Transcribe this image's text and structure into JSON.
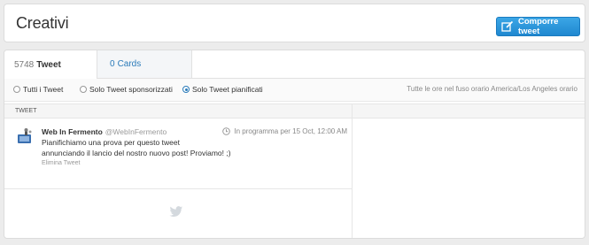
{
  "header": {
    "title": "Creativi",
    "compose_button_label": "Comporre tweet",
    "compose_icon": "compose-icon"
  },
  "tabs": [
    {
      "count": "5748",
      "label": "Tweet",
      "active": true
    },
    {
      "count": "0",
      "label": "Cards",
      "active": false
    }
  ],
  "filters": {
    "options": [
      {
        "label": "Tutti i Tweet",
        "selected": false
      },
      {
        "label": "Solo Tweet sponsorizzati",
        "selected": false
      },
      {
        "label": "Solo Tweet pianificati",
        "selected": true
      }
    ],
    "timezone_note": "Tutte le ore nel fuso orario America/Los Angeles orario"
  },
  "table": {
    "column_header": "TWEET",
    "rows": [
      {
        "name": "Web In Fermento",
        "handle": "@WebInFermento",
        "status": "In programma per 15 Oct, 12:00 AM",
        "text_line1": "Pianifichiamo una prova per questo tweet",
        "text_line2": "annunciando il lancio del nostro nuovo post! Proviamo! ;)",
        "delete_label": "Elimina Tweet"
      }
    ]
  },
  "colors": {
    "accent": "#2b7bb9",
    "button": "#1f88d0"
  },
  "icons": [
    "compose-icon",
    "clock-icon",
    "bird-icon",
    "avatar"
  ]
}
